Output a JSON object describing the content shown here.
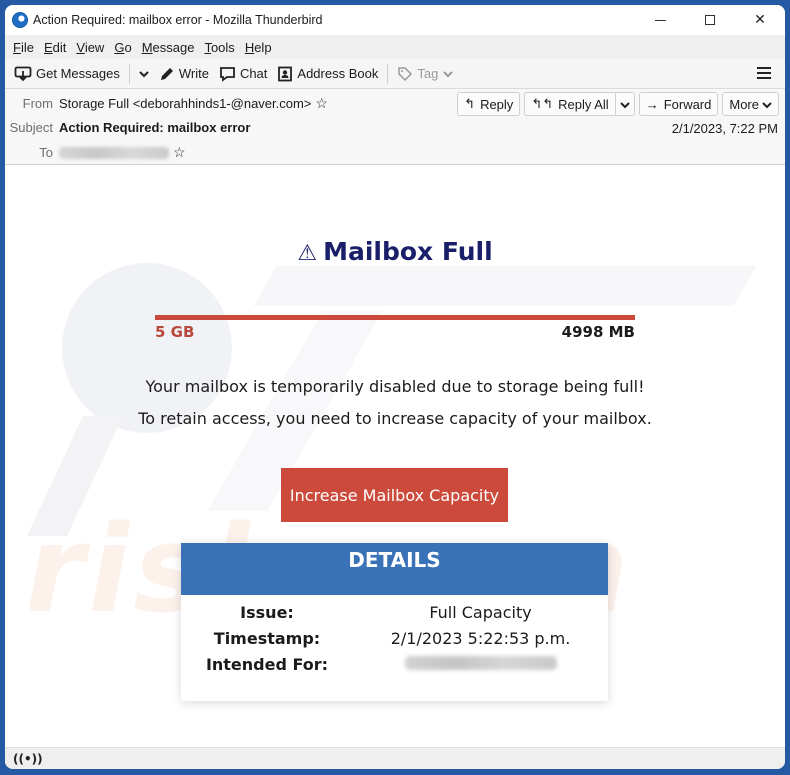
{
  "window": {
    "title": "Action Required: mailbox error - Mozilla Thunderbird",
    "controls": {
      "minimize": "minimize",
      "maximize": "maximize",
      "close": "✕"
    }
  },
  "menubar": {
    "items": [
      {
        "label": "File",
        "accel": "F",
        "rest": "ile"
      },
      {
        "label": "Edit",
        "accel": "E",
        "rest": "dit"
      },
      {
        "label": "View",
        "accel": "V",
        "rest": "iew"
      },
      {
        "label": "Go",
        "accel": "G",
        "rest": "o"
      },
      {
        "label": "Message",
        "accel": "M",
        "rest": "essage"
      },
      {
        "label": "Tools",
        "accel": "T",
        "rest": "ools"
      },
      {
        "label": "Help",
        "accel": "H",
        "rest": "elp"
      }
    ]
  },
  "toolbar": {
    "get_messages": "Get Messages",
    "write": "Write",
    "chat": "Chat",
    "address_book": "Address Book",
    "tag": "Tag"
  },
  "header": {
    "from_label": "From",
    "from_value": "Storage Full <deborahhinds1-@naver.com>",
    "subject_label": "Subject",
    "subject_value": "Action Required: mailbox error",
    "to_label": "To",
    "date": "2/1/2023, 7:22 PM",
    "actions": {
      "reply": "Reply",
      "reply_all": "Reply All",
      "forward": "Forward",
      "more": "More"
    }
  },
  "email": {
    "title": "Mailbox Full",
    "warning_icon": "⚠",
    "storage_bar": {
      "left_label": "5 GB",
      "right_label": "4998 MB",
      "fill_fraction": 1.0,
      "color": "#c9493b"
    },
    "paragraph": "Your mailbox is temporarily disabled due to storage being full! To retain access, you need to increase capacity of your mailbox.",
    "cta_label": "Increase Mailbox Capacity",
    "cta_color": "#cc4a3c",
    "details": {
      "heading": "DETAILS",
      "heading_color": "#3a72b8",
      "rows": [
        {
          "key": "Issue:",
          "value": "Full Capacity"
        },
        {
          "key": "Timestamp:",
          "value": "2/1/2023 5:22:53 p.m."
        },
        {
          "key": "Intended For:",
          "value": ""
        }
      ]
    },
    "watermark": "risk.com"
  },
  "statusbar": {
    "icon": "((•))"
  }
}
